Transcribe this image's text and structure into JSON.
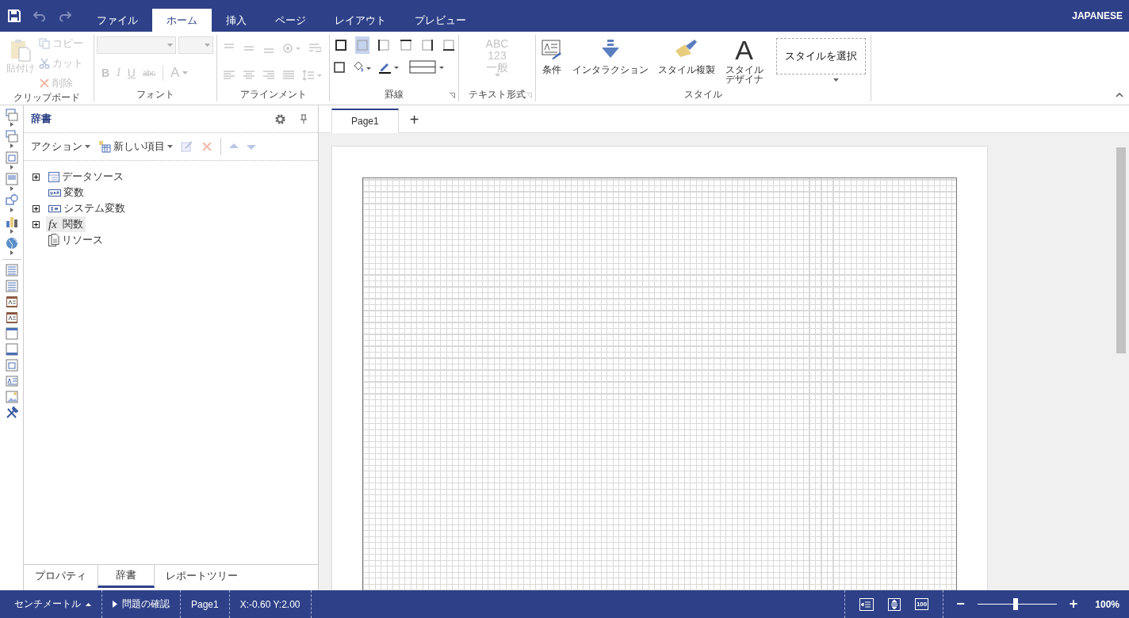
{
  "menu": {
    "tabs": [
      {
        "label": "ファイル",
        "selected": false
      },
      {
        "label": "ホーム",
        "selected": true
      },
      {
        "label": "挿入",
        "selected": false
      },
      {
        "label": "ページ",
        "selected": false
      },
      {
        "label": "レイアウト",
        "selected": false
      },
      {
        "label": "プレビュー",
        "selected": false
      }
    ],
    "language": "JAPANESE"
  },
  "ribbon": {
    "clipboard": {
      "paste": {
        "label": "貼付け",
        "disabled": true
      },
      "actions": [
        {
          "label": "コピー",
          "kind": "copy",
          "disabled": true
        },
        {
          "label": "カット",
          "kind": "cut",
          "disabled": true
        },
        {
          "label": "削除",
          "kind": "delete",
          "disabled": true
        }
      ],
      "group_label": "クリップボード"
    },
    "font": {
      "format_buttons": [
        {
          "label": "B",
          "kind": "bold",
          "disabled": true
        },
        {
          "label": "I",
          "kind": "italic",
          "disabled": true
        },
        {
          "label": "U",
          "kind": "underline",
          "disabled": true
        },
        {
          "label": "abc",
          "kind": "strike",
          "disabled": true
        }
      ],
      "color_button": "A",
      "group_label": "フォント"
    },
    "alignment": {
      "group_label": "アラインメント"
    },
    "borders": {
      "buttons": [
        {
          "kind": "all",
          "selected": false
        },
        {
          "kind": "none",
          "selected": true
        },
        {
          "kind": "left",
          "selected": false
        },
        {
          "kind": "top",
          "selected": false
        },
        {
          "kind": "right",
          "selected": false
        },
        {
          "kind": "bottom",
          "selected": false
        }
      ],
      "group_label": "罫線"
    },
    "text_format": {
      "sample": [
        "ABC",
        "123",
        "一般"
      ],
      "group_label": "テキスト形式"
    },
    "style": {
      "buttons": [
        {
          "label": "条件",
          "kind": "condition"
        },
        {
          "label": "インタラクション",
          "kind": "interaction"
        },
        {
          "label": "スタイル複製",
          "kind": "brush"
        },
        {
          "label": "スタイルデザイナ",
          "kind": "designer",
          "glyph": "A"
        }
      ],
      "selector": "スタイルを選択",
      "group_label": "スタイル"
    }
  },
  "panel": {
    "title": "辞書",
    "actions": "アクション",
    "new_item": "新しい項目",
    "tree": [
      {
        "label": "データソース",
        "kind": "datasource",
        "expanded": false,
        "selected": false
      },
      {
        "label": "変数",
        "kind": "variable",
        "selected": false
      },
      {
        "label": "システム変数",
        "kind": "system",
        "expanded": false,
        "selected": false
      },
      {
        "label": "関数",
        "kind": "function",
        "glyph": "fx",
        "expanded": false,
        "selected": true
      },
      {
        "label": "リソース",
        "kind": "resource",
        "selected": false
      }
    ],
    "bottom_tabs": [
      {
        "label": "プロパティ",
        "selected": false
      },
      {
        "label": "辞書",
        "selected": true
      },
      {
        "label": "レポートツリー",
        "selected": false
      }
    ]
  },
  "designer": {
    "page_tabs": [
      {
        "label": "Page1",
        "selected": true
      }
    ],
    "add_tab": "+"
  },
  "status_bar": {
    "units": "センチメートル",
    "check_issues": "問題の確認",
    "page": "Page1",
    "position": "X:-0.60 Y:2.00",
    "actual_size": "100",
    "zoom_out": "−",
    "zoom_in": "+",
    "zoom": {
      "level": 0.48
    },
    "zoom_text": "100%"
  }
}
